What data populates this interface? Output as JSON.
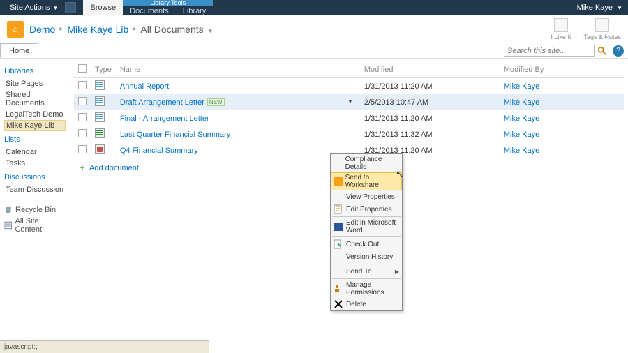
{
  "topbar": {
    "site_actions": "Site Actions",
    "library_tools": "Library Tools",
    "tabs": {
      "browse": "Browse",
      "documents": "Documents",
      "library": "Library"
    },
    "user": "Mike Kaye"
  },
  "breadcrumb": {
    "a": "Demo",
    "b": "Mike Kaye Lib",
    "c": "All Documents"
  },
  "title_actions": {
    "like": "I Like It",
    "tags": "Tags & Notes"
  },
  "subnav": {
    "home": "Home"
  },
  "search": {
    "placeholder": "Search this site..."
  },
  "leftnav": {
    "libraries": "Libraries",
    "site_pages": "Site Pages",
    "shared_docs": "Shared Documents",
    "legaltech": "LegalTech Demo",
    "mike_lib": "Mike Kaye Lib",
    "lists": "Lists",
    "calendar": "Calendar",
    "tasks": "Tasks",
    "discussions": "Discussions",
    "team_discussion": "Team Discussion",
    "recycle": "Recycle Bin",
    "all_site": "All Site Content"
  },
  "columns": {
    "type": "Type",
    "name": "Name",
    "modified": "Modified",
    "modified_by": "Modified By"
  },
  "rows": [
    {
      "icon": "doc",
      "name": "Annual Report",
      "new": false,
      "modified": "1/31/2013 11:20 AM",
      "by": "Mike Kaye"
    },
    {
      "icon": "doc",
      "name": "Draft Arrangement Letter",
      "new": true,
      "modified": "2/5/2013 10:47 AM",
      "by": "Mike Kaye",
      "selected": true
    },
    {
      "icon": "doc",
      "name": "Final - Arrangement Letter",
      "new": false,
      "modified": "1/31/2013 11:20 AM",
      "by": "Mike Kaye"
    },
    {
      "icon": "xls",
      "name": "Last Quarter Financial Summary",
      "new": false,
      "modified": "1/31/2013 11:32 AM",
      "by": "Mike Kaye"
    },
    {
      "icon": "ppt",
      "name": "Q4 Financial Summary",
      "new": false,
      "modified": "1/31/2013 11:20 AM",
      "by": "Mike Kaye"
    }
  ],
  "new_badge": "NEW",
  "add_document": "Add document",
  "context_menu": {
    "compliance": "Compliance Details",
    "send_workshare": "Send to Workshare",
    "view_props": "View Properties",
    "edit_props": "Edit Properties",
    "edit_word": "Edit in Microsoft Word",
    "check_out": "Check Out",
    "version_history": "Version History",
    "send_to": "Send To",
    "manage_perms": "Manage Permissions",
    "delete": "Delete"
  },
  "statusbar": "javascript:;"
}
